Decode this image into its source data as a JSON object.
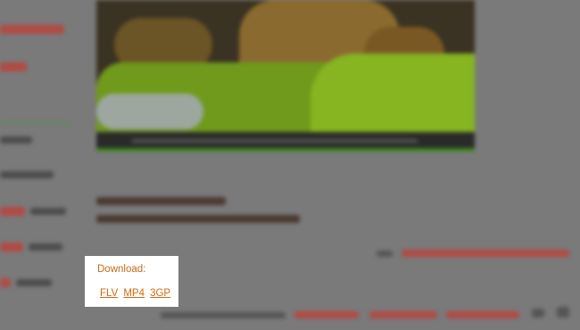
{
  "download": {
    "label": "Download:",
    "formats": [
      "FLV",
      "MP4",
      "3GP"
    ]
  },
  "colors": {
    "page_dim": "#7a7a7a",
    "link_orange": "#d06a10",
    "label_orange": "#c46a1a",
    "box_background": "#ffffff"
  },
  "icons": [
    "play-icon",
    "volume-icon",
    "fullscreen-icon",
    "share-icon",
    "edit-icon"
  ]
}
